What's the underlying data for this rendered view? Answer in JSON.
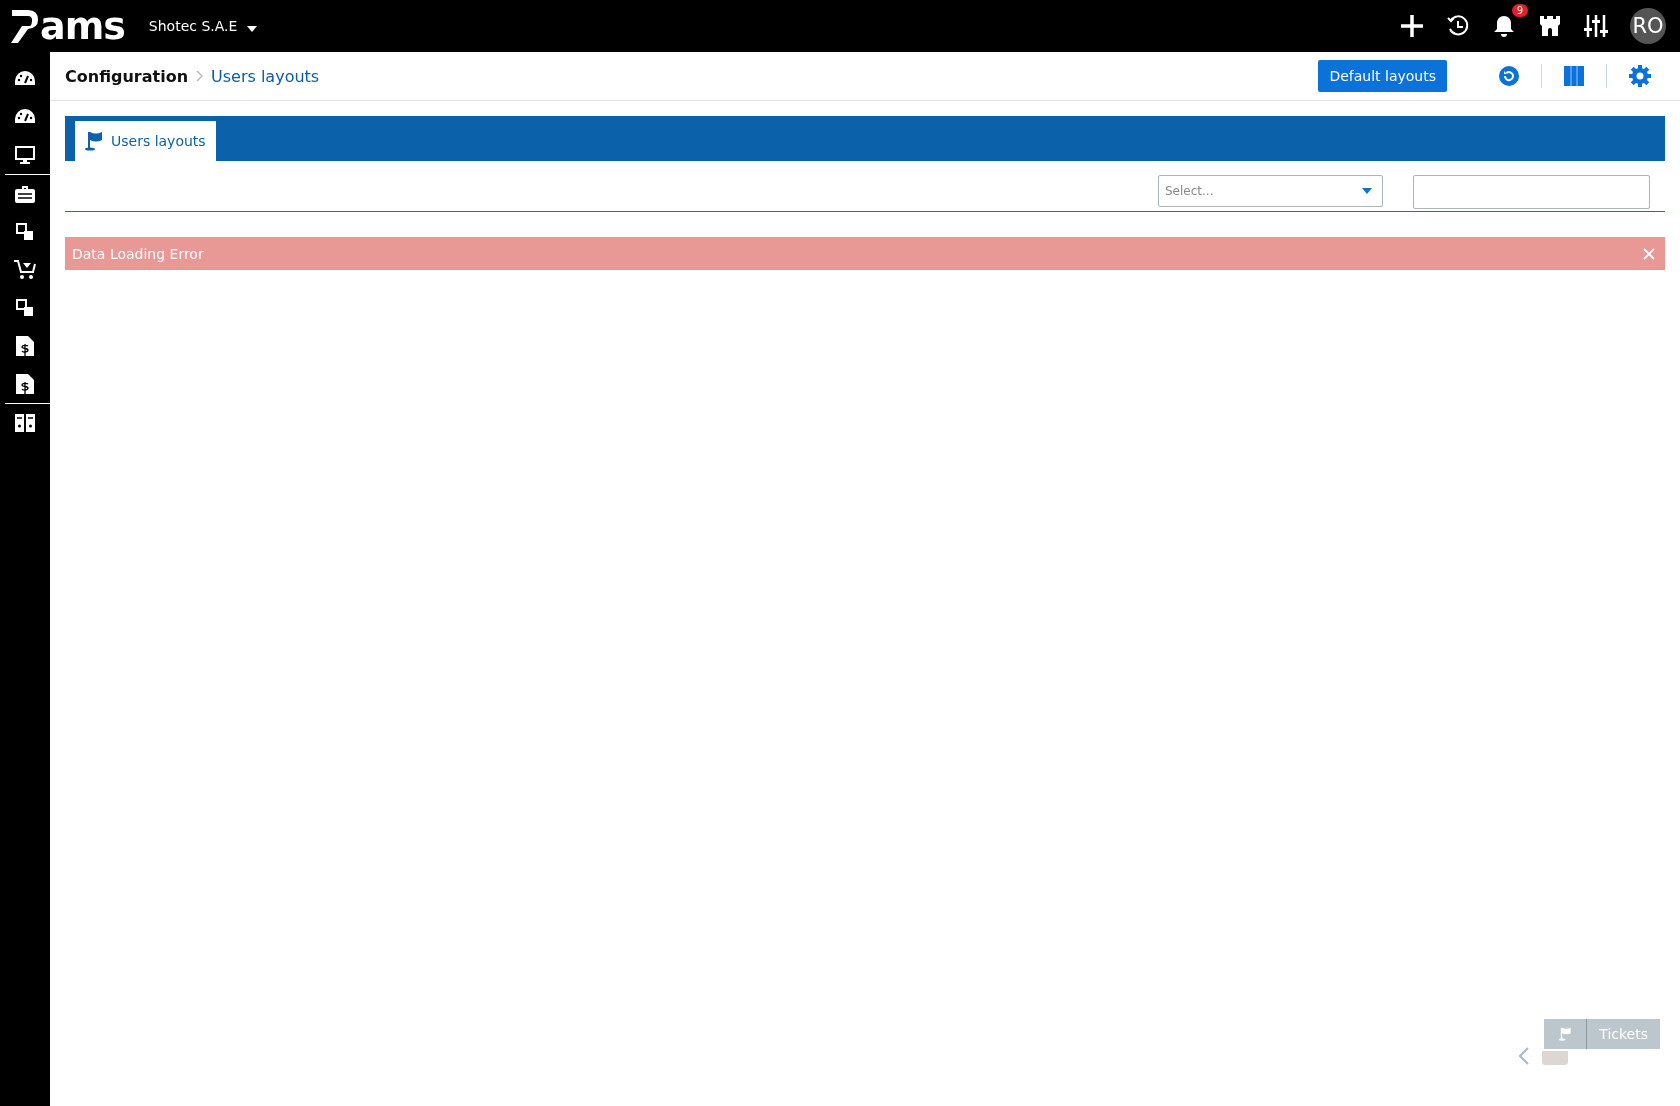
{
  "topbar": {
    "logo": "ams",
    "company": "Shotec S.A.E",
    "notifications": "9",
    "avatar": "RO"
  },
  "breadcrumb": [
    {
      "label": "Configuration",
      "selected": false
    },
    {
      "label": "Users layouts",
      "selected": true
    }
  ],
  "header_button": "Default layouts",
  "tabs": [
    {
      "label": "Users layouts",
      "selected": true
    }
  ],
  "filters": {
    "select_placeholder": "Select..."
  },
  "alert": {
    "message": "Data Loading Error"
  },
  "floating_button": "Tickets"
}
